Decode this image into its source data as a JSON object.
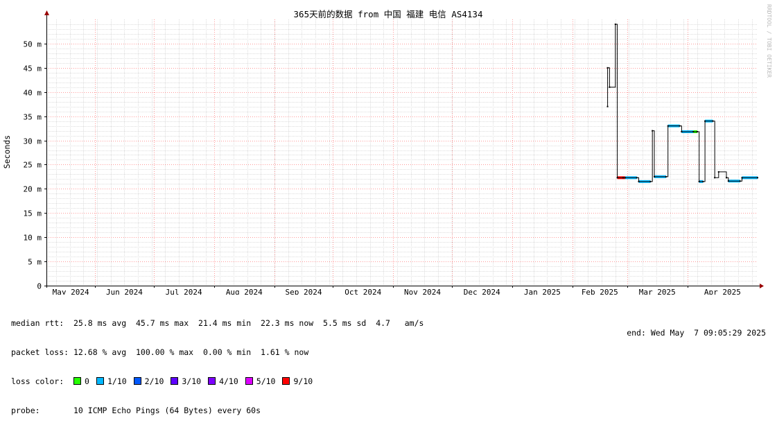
{
  "chart_data": {
    "type": "line",
    "title": "365天前的数据 from 中国 福建 电信 AS4134",
    "ylabel": "Seconds",
    "ylim": [
      0,
      55
    ],
    "yticks": [
      {
        "v": 0,
        "label": "0"
      },
      {
        "v": 5,
        "label": "5 m"
      },
      {
        "v": 10,
        "label": "10 m"
      },
      {
        "v": 15,
        "label": "15 m"
      },
      {
        "v": 20,
        "label": "20 m"
      },
      {
        "v": 25,
        "label": "25 m"
      },
      {
        "v": 30,
        "label": "30 m"
      },
      {
        "v": 35,
        "label": "35 m"
      },
      {
        "v": 40,
        "label": "40 m"
      },
      {
        "v": 45,
        "label": "45 m"
      },
      {
        "v": 50,
        "label": "50 m"
      }
    ],
    "xlim": [
      "2024-05-07",
      "2025-05-07"
    ],
    "xticks": [
      {
        "d": "2024-05-01",
        "label": "May 2024"
      },
      {
        "d": "2024-06-01",
        "label": "Jun 2024"
      },
      {
        "d": "2024-07-01",
        "label": "Jul 2024"
      },
      {
        "d": "2024-08-01",
        "label": "Aug 2024"
      },
      {
        "d": "2024-09-01",
        "label": "Sep 2024"
      },
      {
        "d": "2024-10-01",
        "label": "Oct 2024"
      },
      {
        "d": "2024-11-01",
        "label": "Nov 2024"
      },
      {
        "d": "2024-12-01",
        "label": "Dec 2024"
      },
      {
        "d": "2025-01-01",
        "label": "Jan 2025"
      },
      {
        "d": "2025-02-01",
        "label": "Feb 2025"
      },
      {
        "d": "2025-03-01",
        "label": "Mar 2025"
      },
      {
        "d": "2025-04-01",
        "label": "Apr 2025"
      }
    ],
    "grid": true,
    "series": [
      {
        "values": [
          {
            "x": "2025-02-19",
            "y": 37,
            "loss": 0
          },
          {
            "x": "2025-02-19",
            "y": 45,
            "loss": 0
          },
          {
            "x": "2025-02-20",
            "y": 41,
            "loss": 0
          },
          {
            "x": "2025-02-23",
            "y": 54,
            "loss": 100
          },
          {
            "x": "2025-02-24",
            "y": 22.3,
            "loss": 90
          },
          {
            "x": "2025-02-27",
            "y": 22.3,
            "loss": 90
          },
          {
            "x": "2025-02-28",
            "y": 22.3,
            "loss": 10
          },
          {
            "x": "2025-03-06",
            "y": 22.3,
            "loss": 10
          },
          {
            "x": "2025-03-07",
            "y": 21.5,
            "loss": 10
          },
          {
            "x": "2025-03-13",
            "y": 21.5,
            "loss": 10
          },
          {
            "x": "2025-03-14",
            "y": 32,
            "loss": 0
          },
          {
            "x": "2025-03-15",
            "y": 22.5,
            "loss": 10
          },
          {
            "x": "2025-03-21",
            "y": 22.5,
            "loss": 10
          },
          {
            "x": "2025-03-22",
            "y": 33,
            "loss": 10
          },
          {
            "x": "2025-03-28",
            "y": 33,
            "loss": 10
          },
          {
            "x": "2025-03-29",
            "y": 31.8,
            "loss": 10
          },
          {
            "x": "2025-04-04",
            "y": 31.8,
            "loss": 0
          },
          {
            "x": "2025-04-06",
            "y": 31.8,
            "loss": 10
          },
          {
            "x": "2025-04-07",
            "y": 21.5,
            "loss": 10
          },
          {
            "x": "2025-04-09",
            "y": 21.5,
            "loss": 10
          },
          {
            "x": "2025-04-10",
            "y": 34,
            "loss": 10
          },
          {
            "x": "2025-04-14",
            "y": 34,
            "loss": 10
          },
          {
            "x": "2025-04-15",
            "y": 22.3,
            "loss": 10
          },
          {
            "x": "2025-04-17",
            "y": 23.5,
            "loss": 0
          },
          {
            "x": "2025-04-21",
            "y": 22.3,
            "loss": 10
          },
          {
            "x": "2025-04-22",
            "y": 21.6,
            "loss": 10
          },
          {
            "x": "2025-04-28",
            "y": 21.6,
            "loss": 10
          },
          {
            "x": "2025-04-29",
            "y": 22.3,
            "loss": 10
          },
          {
            "x": "2025-05-07",
            "y": 22.3,
            "loss": 10
          }
        ]
      }
    ]
  },
  "colors": {
    "major_grid": "#ff9999",
    "minor_grid": "#dddddd",
    "line": "#000000",
    "loss_0": "#26ff00",
    "loss_10": "#00b8ff",
    "loss_20": "#0059ff",
    "loss_30": "#5e00ff",
    "loss_40": "#7e00ff",
    "loss_50": "#dd00ff",
    "loss_90": "#ff0000"
  },
  "stats": {
    "median_rtt": "median rtt:  25.8 ms avg  45.7 ms max  21.4 ms min  22.3 ms now  5.5 ms sd  4.7   am/s",
    "packet_loss": "packet loss: 12.68 % avg  100.00 % max  0.00 % min  1.61 % now",
    "loss_color_label": "loss color:",
    "probe": "probe:       10 ICMP Echo Pings (64 Bytes) every 60s",
    "end": "end: Wed May  7 09:05:29 2025"
  },
  "loss_legend": [
    {
      "label": "0",
      "color": "#26ff00"
    },
    {
      "label": "1/10",
      "color": "#00b8ff"
    },
    {
      "label": "2/10",
      "color": "#0059ff"
    },
    {
      "label": "3/10",
      "color": "#5e00ff"
    },
    {
      "label": "4/10",
      "color": "#7e00ff"
    },
    {
      "label": "5/10",
      "color": "#dd00ff"
    },
    {
      "label": "9/10",
      "color": "#ff0000"
    }
  ],
  "credit": "RRDTOOL / TOBI OETIKER"
}
